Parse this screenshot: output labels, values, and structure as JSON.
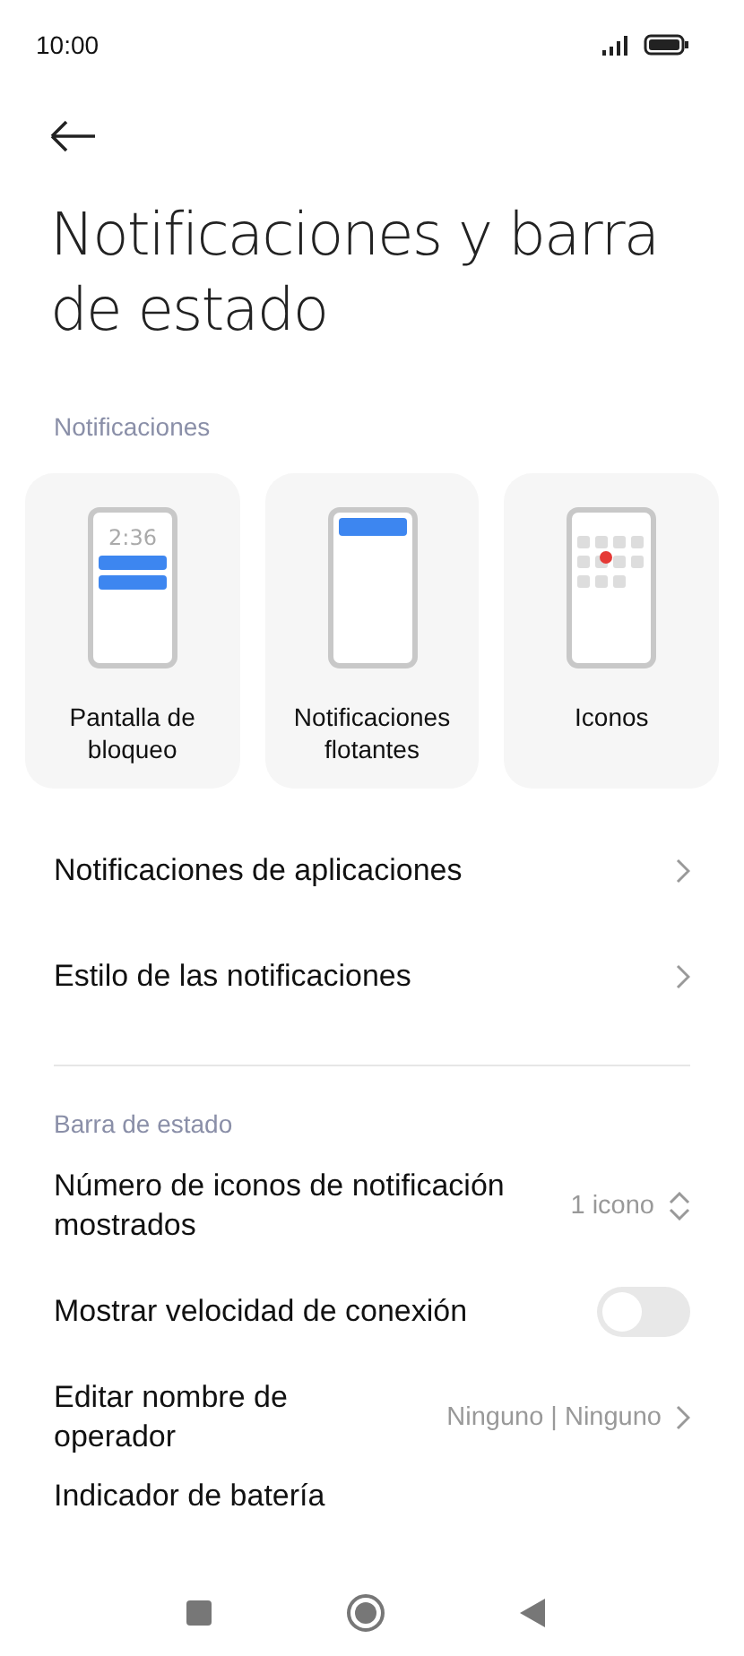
{
  "status_bar": {
    "time": "10:00"
  },
  "title": "Notificaciones y barra de estado",
  "sections": [
    {
      "header": "Notificaciones",
      "cards": [
        {
          "kind": "lock",
          "label": "Pantalla de bloqueo",
          "clock": "2:36"
        },
        {
          "kind": "floating",
          "label": "Notificaciones flotantes"
        },
        {
          "kind": "icons",
          "label": "Iconos"
        }
      ],
      "rows": [
        {
          "kind": "link",
          "label": "Notificaciones de aplicaciones"
        },
        {
          "kind": "link",
          "label": "Estilo de las notificaciones"
        }
      ]
    },
    {
      "header": "Barra de estado",
      "rows": [
        {
          "kind": "stepper",
          "label": "Número de iconos de notificación mostrados",
          "value": "1 icono"
        },
        {
          "kind": "toggle",
          "label": "Mostrar velocidad de conexión",
          "on": false
        },
        {
          "kind": "link",
          "label": "Editar nombre de operador",
          "value": "Ninguno | Ninguno"
        },
        {
          "kind": "cut",
          "label": "Indicador de batería"
        }
      ]
    }
  ]
}
